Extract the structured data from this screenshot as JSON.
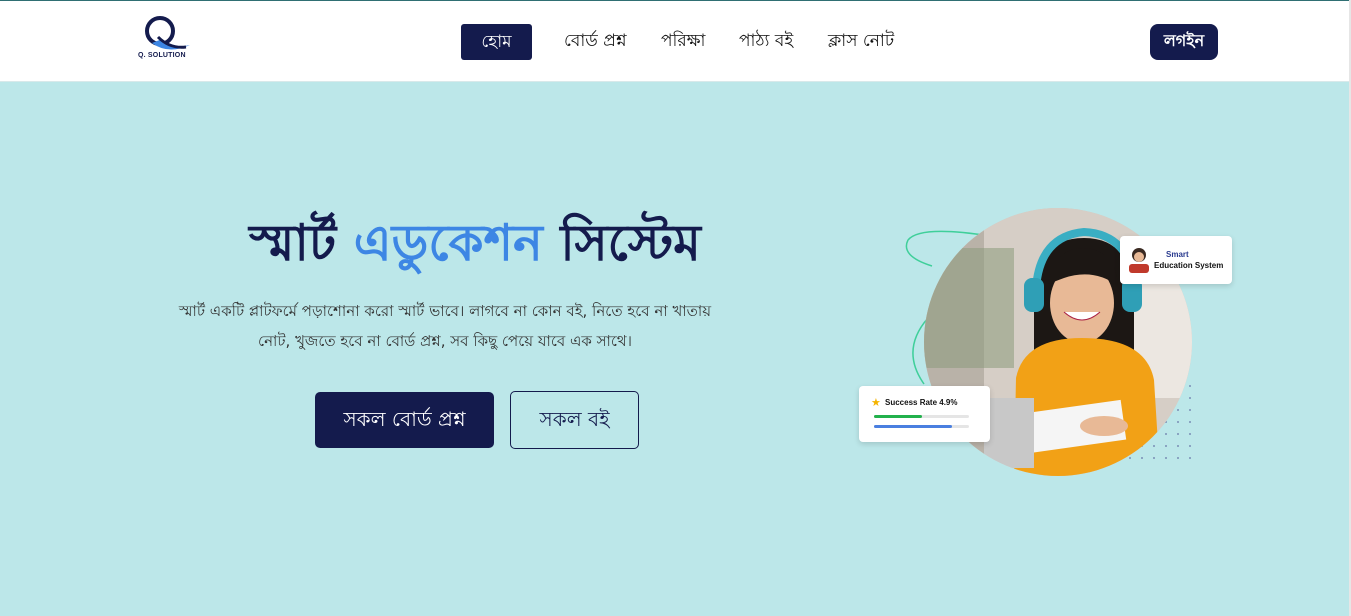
{
  "brand": {
    "logo_text": "Q. SOLUTION",
    "primary_color": "#141b4d",
    "accent_color": "#3d86e4"
  },
  "nav": {
    "items": [
      {
        "label": "হোম",
        "active": true
      },
      {
        "label": "বোর্ড প্রশ্ন",
        "active": false
      },
      {
        "label": "পরিক্ষা",
        "active": false
      },
      {
        "label": "পাঠ্য বই",
        "active": false
      },
      {
        "label": "ক্লাস নোট",
        "active": false
      }
    ],
    "login_label": "লগইন"
  },
  "hero": {
    "title_part1": "স্মার্ট",
    "title_part2": "এডুকেশন",
    "title_part3": "সিস্টেম",
    "description_line1": "স্মার্ট একটি প্লাটফর্মে পড়াশোনা করো স্মার্ট ভাবে। লাগবে না কোন বই, নিতে হবে না খাতায়",
    "description_line2": "নোট, খুজতে হবে না বোর্ড প্রশ্ন, সব কিছু পেয়ে যাবে এক সাথে।",
    "primary_button": "সকল বোর্ড প্রশ্ন",
    "secondary_button": "সকল বই"
  },
  "visual": {
    "card_smart_line1": "Smart",
    "card_smart_line2": "Education System",
    "success_label": "Success Rate 4.9%",
    "bar_green_fraction": 0.5,
    "bar_blue_fraction": 0.82
  }
}
